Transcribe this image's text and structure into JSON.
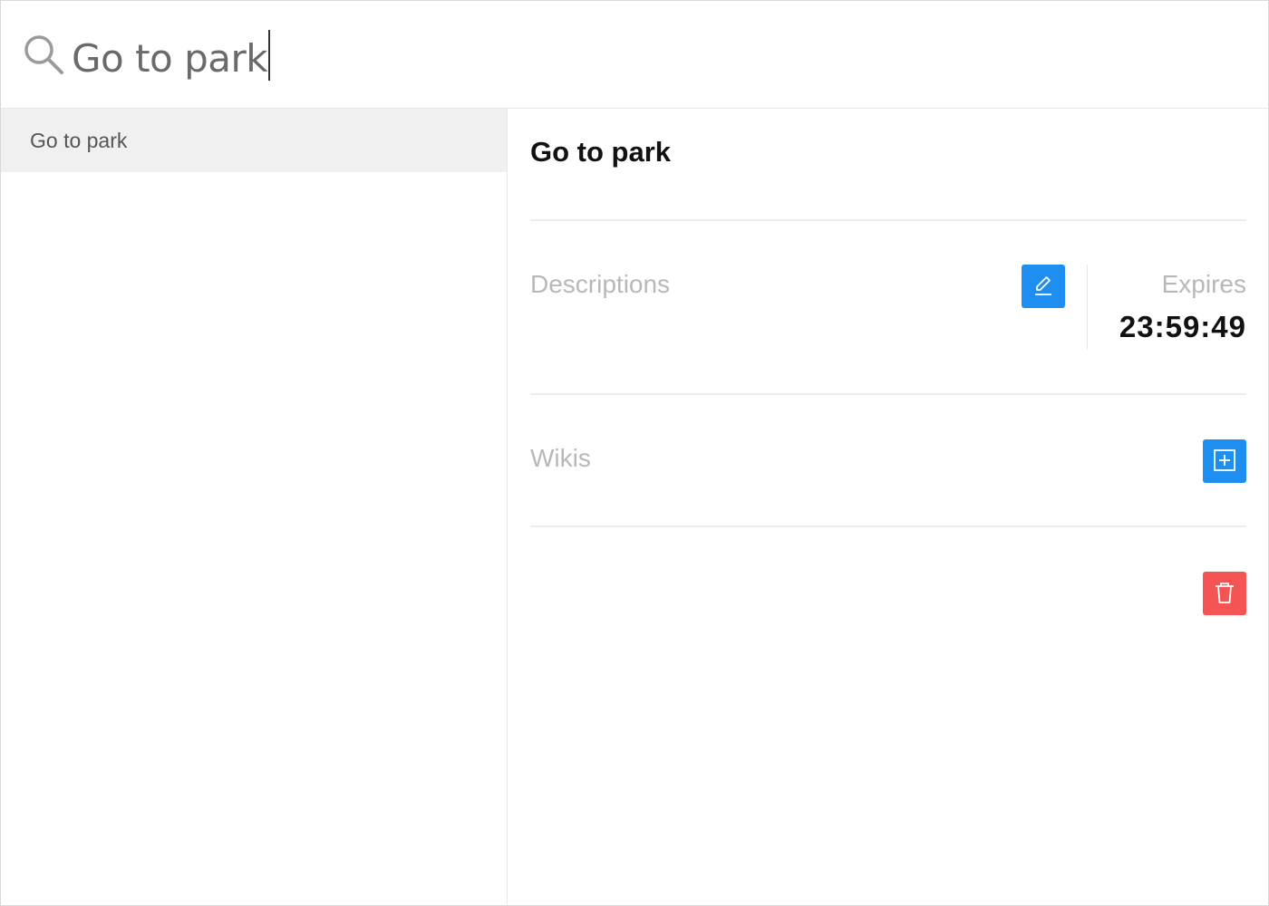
{
  "search": {
    "query": "Go to park",
    "icon": "search-icon"
  },
  "results": [
    {
      "label": "Go to park",
      "selected": true
    }
  ],
  "detail": {
    "title": "Go to park",
    "descriptions_label": "Descriptions",
    "edit_icon": "pencil-icon",
    "expires_label": "Expires",
    "expires_value": "23:59:49",
    "wikis_label": "Wikis",
    "add_icon": "plus-square-icon",
    "delete_icon": "trash-icon"
  },
  "colors": {
    "primary": "#1f8ef1",
    "danger": "#f45454",
    "selected_row": "#f0f0f0",
    "muted_text": "#b8b8b8"
  }
}
